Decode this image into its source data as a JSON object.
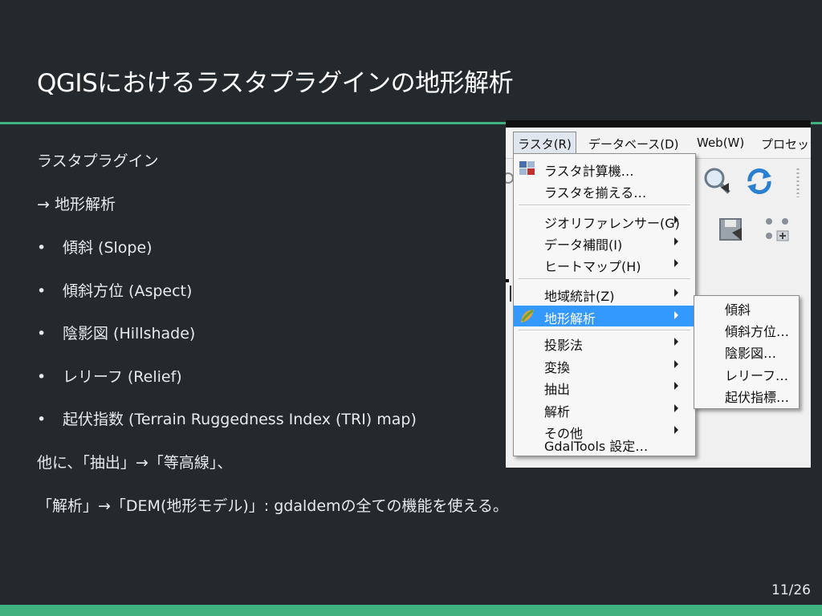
{
  "slide": {
    "title": "QGISにおけるラスタプラグインの地形解析",
    "intro": "ラスタプラグイン",
    "path": "→ 地形解析",
    "bullet_marker": "•",
    "bullets": [
      "傾斜 (Slope)",
      "傾斜方位 (Aspect)",
      "陰影図 (Hillshade)",
      "レリーフ (Relief)",
      "起伏指数 (Terrain Ruggedness Index (TRI) map)"
    ],
    "note1": "他に、「抽出」→「等高線」、",
    "note2": "「解析」→「DEM(地形モデル)」: gdaldemの全ての機能を使える。",
    "page_number": "11/26"
  },
  "screenshot": {
    "menubar": [
      "ラスタ(R)",
      "データベース(D)",
      "Web(W)",
      "プロセッシ"
    ],
    "raster_menu": [
      {
        "label": "ラスタ計算機…",
        "submenu": false,
        "icon": "raster-calculator-icon"
      },
      {
        "label": "ラスタを揃える…",
        "submenu": false,
        "icon": ""
      },
      {
        "label": "ジオリファレンサー(G)",
        "submenu": true,
        "icon": ""
      },
      {
        "label": "データ補間(I)",
        "submenu": true,
        "icon": ""
      },
      {
        "label": "ヒートマップ(H)",
        "submenu": true,
        "icon": ""
      },
      {
        "label": "地域統計(Z)",
        "submenu": true,
        "icon": ""
      },
      {
        "label": "地形解析",
        "submenu": true,
        "icon": "terrain-analysis-icon",
        "active": true
      },
      {
        "label": "投影法",
        "submenu": true,
        "icon": ""
      },
      {
        "label": "変換",
        "submenu": true,
        "icon": ""
      },
      {
        "label": "抽出",
        "submenu": true,
        "icon": ""
      },
      {
        "label": "解析",
        "submenu": true,
        "icon": ""
      },
      {
        "label": "その他",
        "submenu": true,
        "icon": ""
      },
      {
        "label": "GdalTools 設定…",
        "submenu": false,
        "icon": ""
      }
    ],
    "terrain_submenu": [
      "傾斜",
      "傾斜方位…",
      "陰影図…",
      "レリーフ…",
      "起伏指標…"
    ],
    "colors": {
      "highlight": "#3399ff",
      "accent": "#3fb27f",
      "background": "#24292d"
    }
  }
}
